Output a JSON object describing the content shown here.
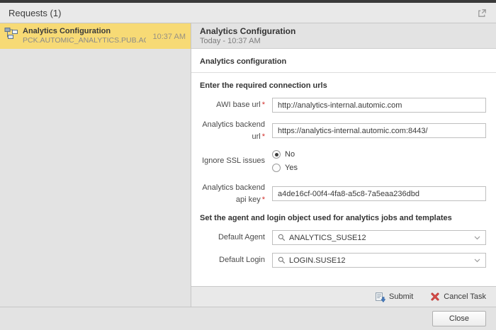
{
  "window": {
    "title": "Requests (1)"
  },
  "request_list": {
    "items": [
      {
        "title": "Analytics Configuration",
        "object_name": "PCK.AUTOMIC_ANALYTICS.PUB.ACTION...",
        "time": "10:37 AM",
        "selected": true
      }
    ]
  },
  "detail": {
    "title": "Analytics Configuration",
    "timestamp": "Today - 10:37 AM",
    "form_title": "Analytics configuration",
    "sections": {
      "connection_heading": "Enter the required connection urls",
      "agent_heading": "Set the agent and login object used for analytics jobs and templates"
    },
    "fields": {
      "awi_base_url": {
        "label": "AWI base url",
        "required_mark": "*",
        "value": "http://analytics-internal.automic.com"
      },
      "backend_url": {
        "label": "Analytics backend url",
        "required_mark": "*",
        "value": "https://analytics-internal.automic.com:8443/"
      },
      "ignore_ssl": {
        "label": "Ignore SSL issues",
        "option_no": "No",
        "option_yes": "Yes",
        "selected": "No"
      },
      "api_key": {
        "label": "Analytics backend api key",
        "required_mark": "*",
        "value": "a4de16cf-00f4-4fa8-a5c8-7a5eaa236dbd"
      },
      "default_agent": {
        "label": "Default Agent",
        "value": "ANALYTICS_SUSE12"
      },
      "default_login": {
        "label": "Default Login",
        "value": "LOGIN.SUSE12"
      }
    }
  },
  "toolbar": {
    "submit": "Submit",
    "cancel": "Cancel Task"
  },
  "footer": {
    "close": "Close"
  },
  "icons": {
    "open_external": "open-in-new-window-icon",
    "workflow": "workflow-object-icon",
    "search": "search-icon",
    "chevron": "chevron-down-icon",
    "submit": "submit-document-icon",
    "cancel": "cancel-x-icon"
  },
  "colors": {
    "selection-yellow": "#f7da75",
    "cancel-red": "#c0392b",
    "submit-blue": "#4a7fc1",
    "panel-gray": "#e3e3e3",
    "border-gray": "#c6c6c6"
  }
}
